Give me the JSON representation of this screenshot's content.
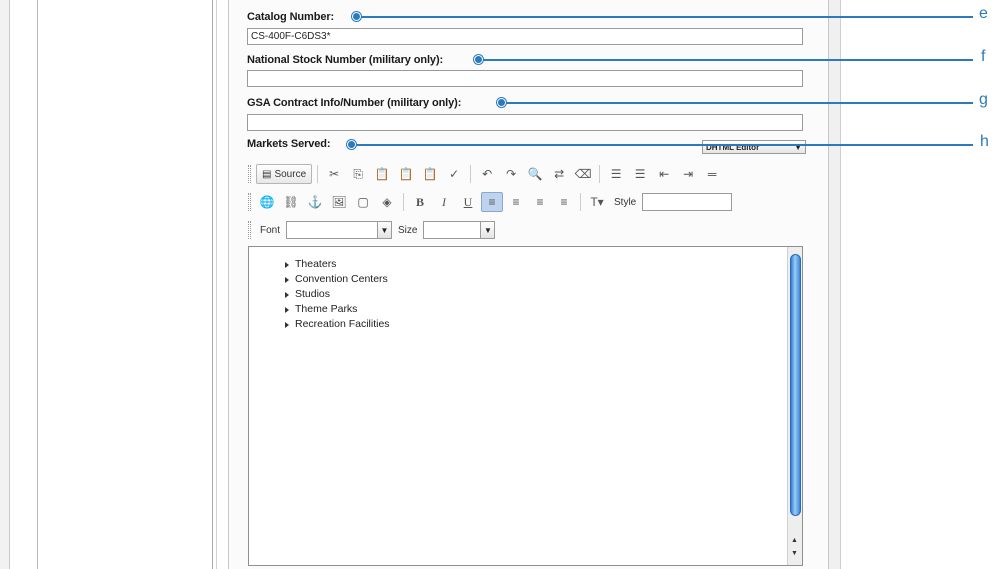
{
  "form": {
    "catalog_number": {
      "label": "Catalog Number:",
      "value": "CS-400F-C6DS3*"
    },
    "national_stock_number": {
      "label": "National Stock Number (military only):",
      "value": ""
    },
    "gsa_contract": {
      "label": "GSA Contract Info/Number (military only):",
      "value": ""
    },
    "markets_served": {
      "label": "Markets Served:"
    }
  },
  "editor_mode": {
    "selected": "DHTML Editor"
  },
  "callouts": [
    "e",
    "f",
    "g",
    "h"
  ],
  "toolbar": {
    "source_label": "Source",
    "style_label": "Style",
    "font_label": "Font",
    "size_label": "Size"
  },
  "editor_content": {
    "items": [
      "Theaters",
      "Convention Centers",
      "Studios",
      "Theme Parks",
      "Recreation Facilities"
    ]
  },
  "colors": {
    "callout": "#2a7bbd",
    "scroll_thumb": "#3b86d8",
    "active_button": "#bfd3ee"
  }
}
